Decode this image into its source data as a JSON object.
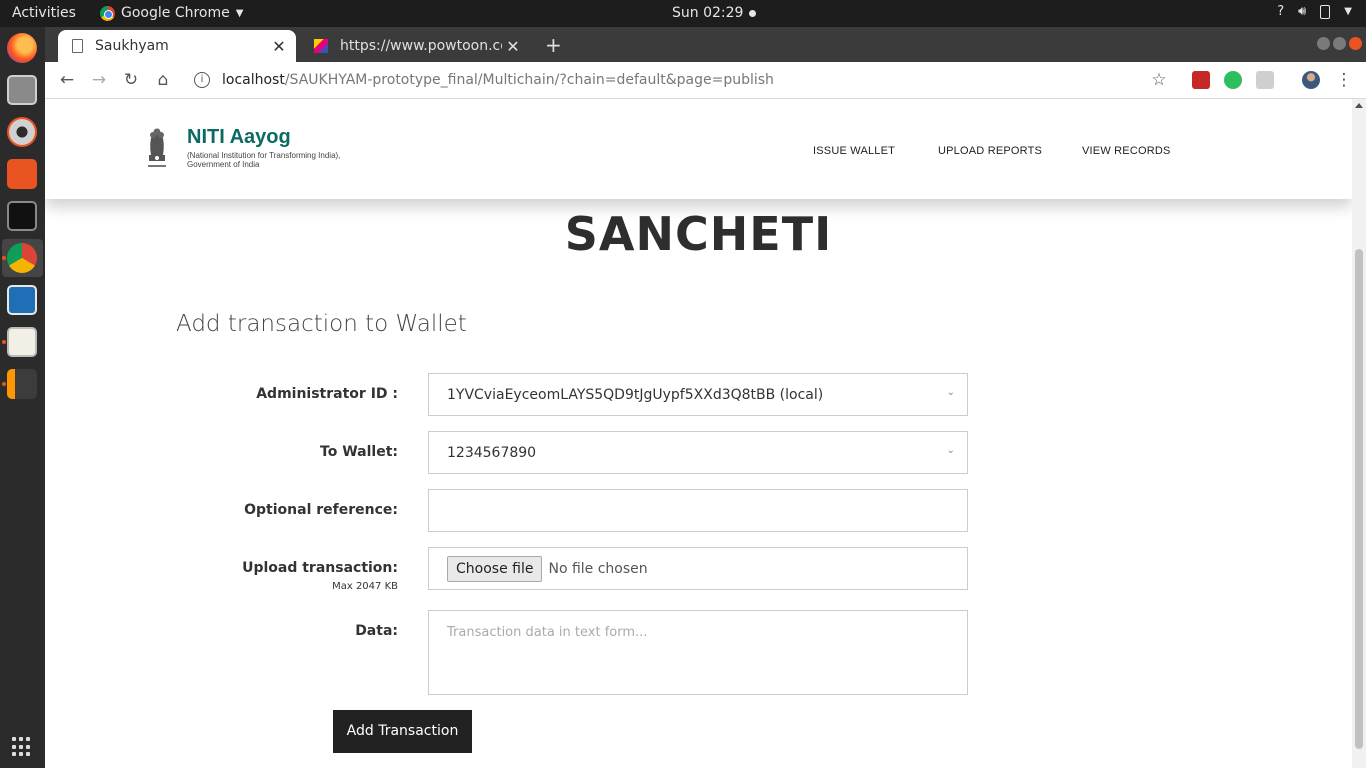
{
  "system": {
    "activities": "Activities",
    "app_menu": "Google Chrome",
    "clock": "Sun 02:29",
    "tray_help": "?"
  },
  "browser": {
    "tabs": [
      {
        "title": "Saukhyam",
        "active": true
      },
      {
        "title": "https://www.powtoon.co",
        "active": false
      }
    ],
    "url_host": "localhost",
    "url_path": "/SAUKHYAM-prototype_final/Multichain/?chain=default&page=publish"
  },
  "site": {
    "brand_title": "NITI Aayog",
    "brand_sub_1": "(National Institution for Transforming India),",
    "brand_sub_2": "Government of India",
    "nav": [
      "ISSUE WALLET",
      "UPLOAD REPORTS",
      "VIEW RECORDS"
    ]
  },
  "page": {
    "company": "SANCHETI",
    "heading": "Add transaction to Wallet"
  },
  "form": {
    "admin_label": "Administrator ID :",
    "admin_value": "1YVCviaEyceomLAYS5QD9tJgUypf5XXd3Q8tBB (local)",
    "wallet_label": "To Wallet:",
    "wallet_value": "1234567890",
    "reference_label": "Optional reference:",
    "upload_label": "Upload transaction:",
    "upload_hint": "Max 2047 KB",
    "file_button": "Choose file",
    "file_status": "No file chosen",
    "data_label": "Data:",
    "data_placeholder": "Transaction data in text form...",
    "submit": "Add Transaction"
  },
  "colors": {
    "brand_teal": "#0b6b62",
    "button_dark": "#222222"
  }
}
